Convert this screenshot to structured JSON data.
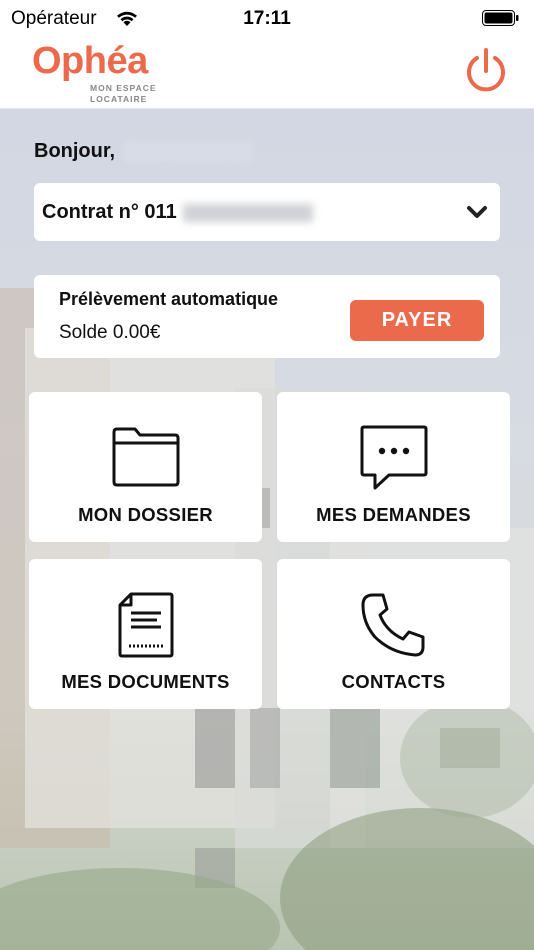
{
  "status_bar": {
    "carrier": "Opérateur",
    "time": "17:11"
  },
  "header": {
    "logo_word": "Ophéa",
    "logo_line1": "MON ESPACE",
    "logo_line2": "LOCATAIRE",
    "accent_color": "#ec6a4c"
  },
  "greeting": "Bonjour,",
  "contract": {
    "label": "Contrat n° 011"
  },
  "payment": {
    "title": "Prélèvement automatique",
    "balance": "Solde 0.00€",
    "pay_label": "PAYER"
  },
  "tiles": [
    {
      "label": "MON DOSSIER",
      "icon": "folder-icon"
    },
    {
      "label": "MES DEMANDES",
      "icon": "chat-bubble-icon"
    },
    {
      "label": "MES DOCUMENTS",
      "icon": "document-icon"
    },
    {
      "label": "CONTACTS",
      "icon": "phone-icon"
    }
  ]
}
